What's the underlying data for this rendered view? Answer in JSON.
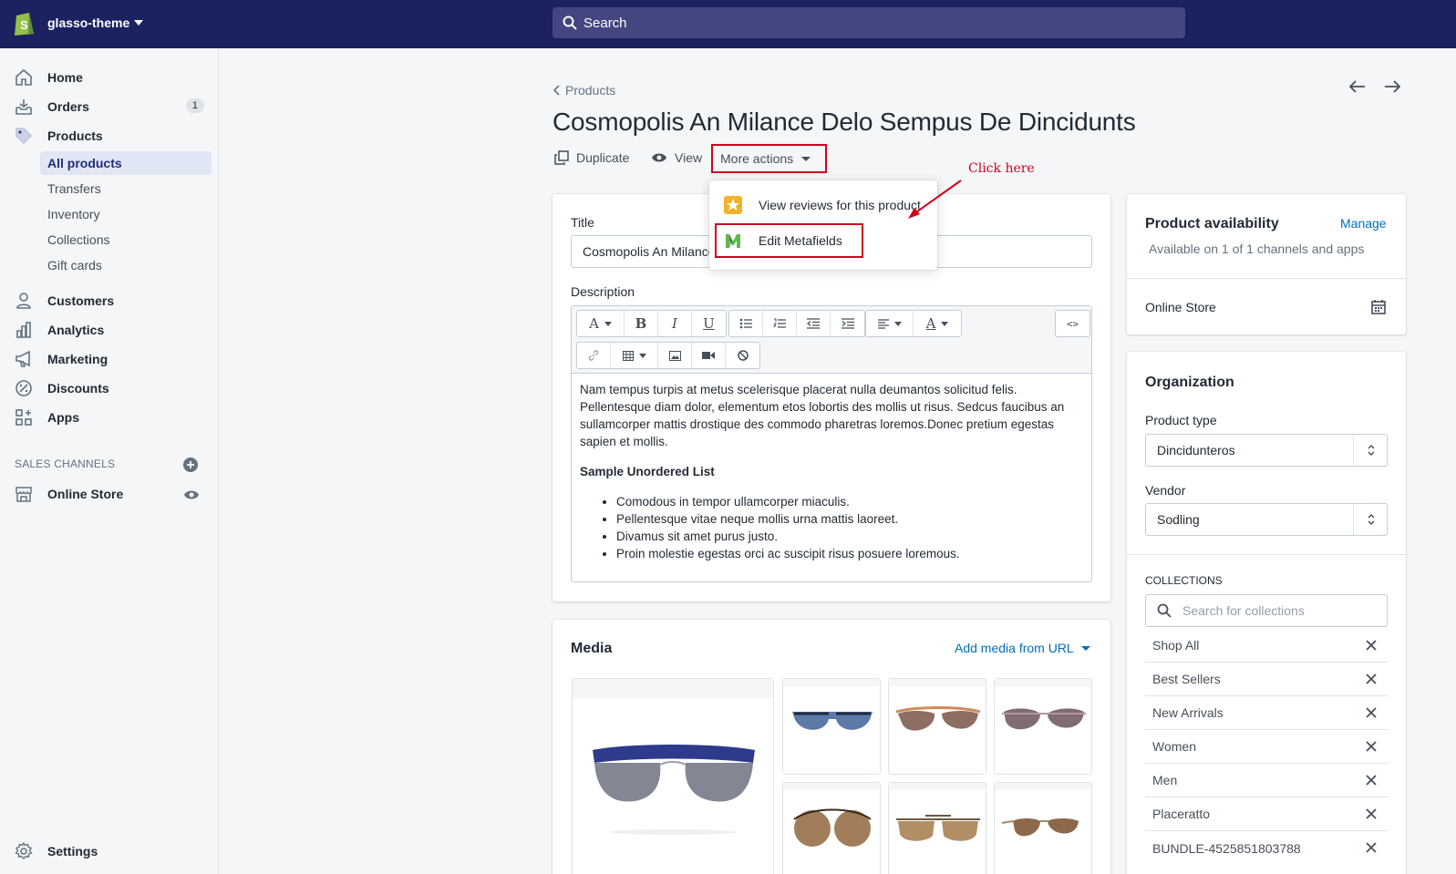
{
  "topbar": {
    "shop_name": "glasso-theme",
    "search_placeholder": "Search"
  },
  "sidebar": {
    "items": [
      {
        "label": "Home",
        "icon": "home-icon"
      },
      {
        "label": "Orders",
        "icon": "orders-icon",
        "badge": "1"
      },
      {
        "label": "Products",
        "icon": "tag-icon"
      },
      {
        "label": "Customers",
        "icon": "person-icon"
      },
      {
        "label": "Analytics",
        "icon": "analytics-icon"
      },
      {
        "label": "Marketing",
        "icon": "megaphone-icon"
      },
      {
        "label": "Discounts",
        "icon": "discount-icon"
      },
      {
        "label": "Apps",
        "icon": "apps-icon"
      }
    ],
    "product_subitems": [
      "All products",
      "Transfers",
      "Inventory",
      "Collections",
      "Gift cards"
    ],
    "sales_channels_heading": "SALES CHANNELS",
    "online_store": "Online Store",
    "settings": "Settings"
  },
  "header": {
    "breadcrumb": "Products",
    "title": "Cosmopolis An Milance Delo Sempus De Dincidunts",
    "duplicate": "Duplicate",
    "view": "View",
    "more_actions": "More actions"
  },
  "dropdown": {
    "view_reviews": "View reviews for this product",
    "edit_metafields": "Edit Metafields"
  },
  "annotation": {
    "text": "Click here",
    "color": "#d0021b"
  },
  "product_form": {
    "title_label": "Title",
    "title_value": "Cosmopolis An Milance Delo Sempus De Dincidunts",
    "description_label": "Description",
    "description_paragraph": "Nam tempus turpis at metus scelerisque placerat nulla deumantos solicitud felis. Pellentesque diam dolor, elementum etos lobortis des mollis ut risus. Sedcus faucibus an sullamcorper mattis drostique des commodo pharetras loremos.Donec pretium egestas sapien et mollis.",
    "list_heading": "Sample Unordered List",
    "list_items": [
      "Comodous in tempor ullamcorper miaculis.",
      "Pellentesque vitae neque mollis urna mattis laoreet.",
      "Divamus sit amet purus justo.",
      "Proin molestie egestas orci ac suscipit risus posuere loremous."
    ]
  },
  "media": {
    "title": "Media",
    "add_link": "Add media from URL"
  },
  "availability": {
    "title": "Product availability",
    "manage": "Manage",
    "subtitle": "Available on 1 of 1 channels and apps",
    "channel": "Online Store"
  },
  "organization": {
    "title": "Organization",
    "product_type_label": "Product type",
    "product_type_value": "Dincidunteros",
    "vendor_label": "Vendor",
    "vendor_value": "Sodling",
    "collections_label": "COLLECTIONS",
    "collections_placeholder": "Search for collections",
    "collections": [
      "Shop All",
      "Best Sellers",
      "New Arrivals",
      "Women",
      "Men",
      "Placeratto",
      "BUNDLE-4525851803788"
    ]
  },
  "colors": {
    "topbar": "#1c2260",
    "accent_link": "#006fbb",
    "highlight": "#d0021b",
    "active_nav_bg": "#e1e6f5"
  }
}
